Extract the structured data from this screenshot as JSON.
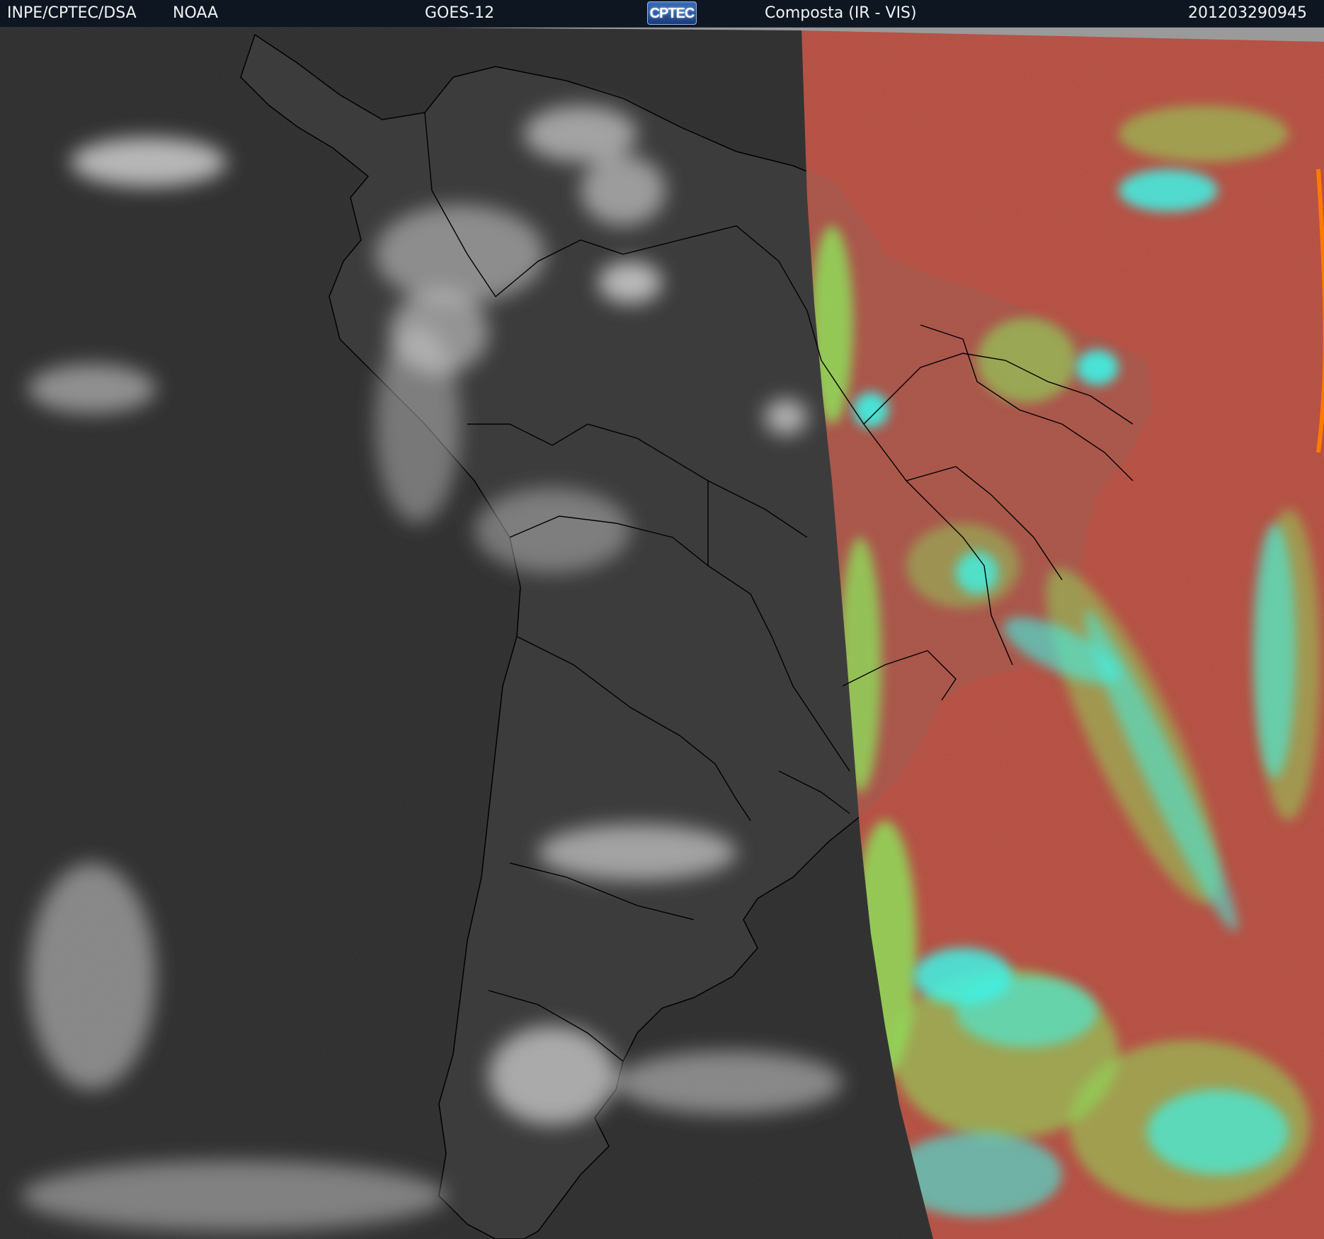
{
  "header": {
    "institution": "INPE/CPTEC/DSA",
    "agency": "NOAA",
    "satellite": "GOES-12",
    "logo_text": "CPTEC",
    "product": "Composta (IR - VIS)",
    "timestamp": "201203290945"
  },
  "colors": {
    "header_bg": "#0d1621",
    "ir_ocean": "#2e2e2e",
    "ir_land": "#3a3a3a",
    "vis_background": "#b54a3c",
    "vis_cloud_low": "#8fdc5a",
    "vis_cloud_high": "#3ff2e6",
    "border_lines": "#000000"
  }
}
